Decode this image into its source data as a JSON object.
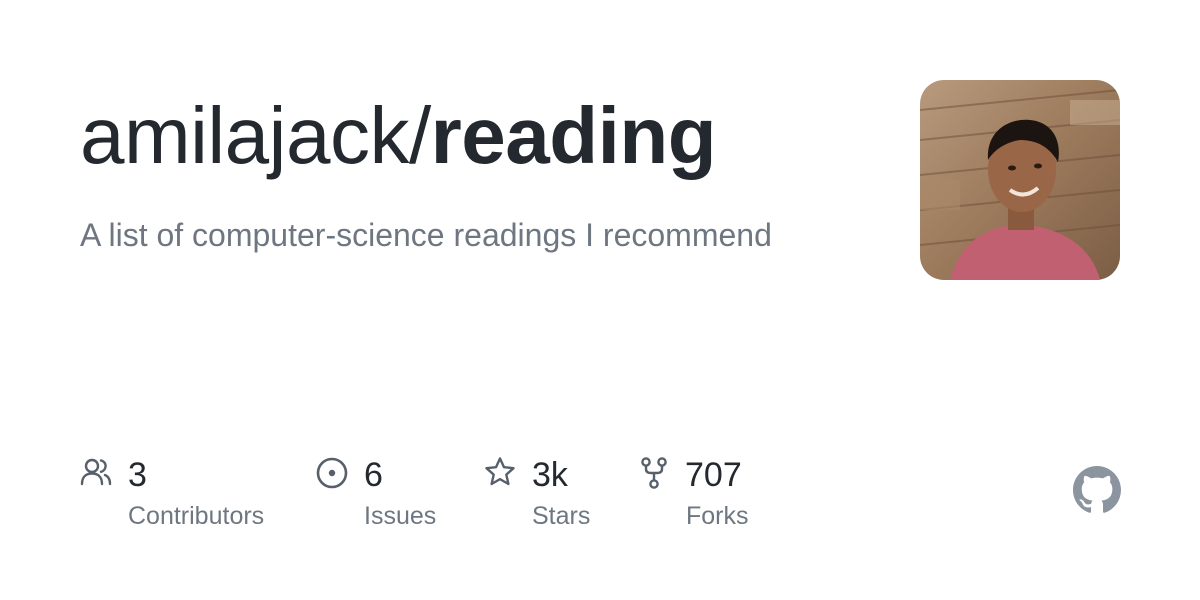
{
  "repo": {
    "owner": "amilajack/",
    "name": "reading",
    "description": "A list of computer-science readings I recommend"
  },
  "stats": [
    {
      "value": "3",
      "label": "Contributors",
      "icon": "people-icon"
    },
    {
      "value": "6",
      "label": "Issues",
      "icon": "issue-opened-icon"
    },
    {
      "value": "3k",
      "label": "Stars",
      "icon": "star-icon"
    },
    {
      "value": "707",
      "label": "Forks",
      "icon": "fork-icon"
    }
  ],
  "colors": {
    "text": "#24292f",
    "muted": "#6e7781",
    "icon": "#57606a",
    "logo": "#8c959f"
  },
  "logo_icon": "github-mark-icon"
}
